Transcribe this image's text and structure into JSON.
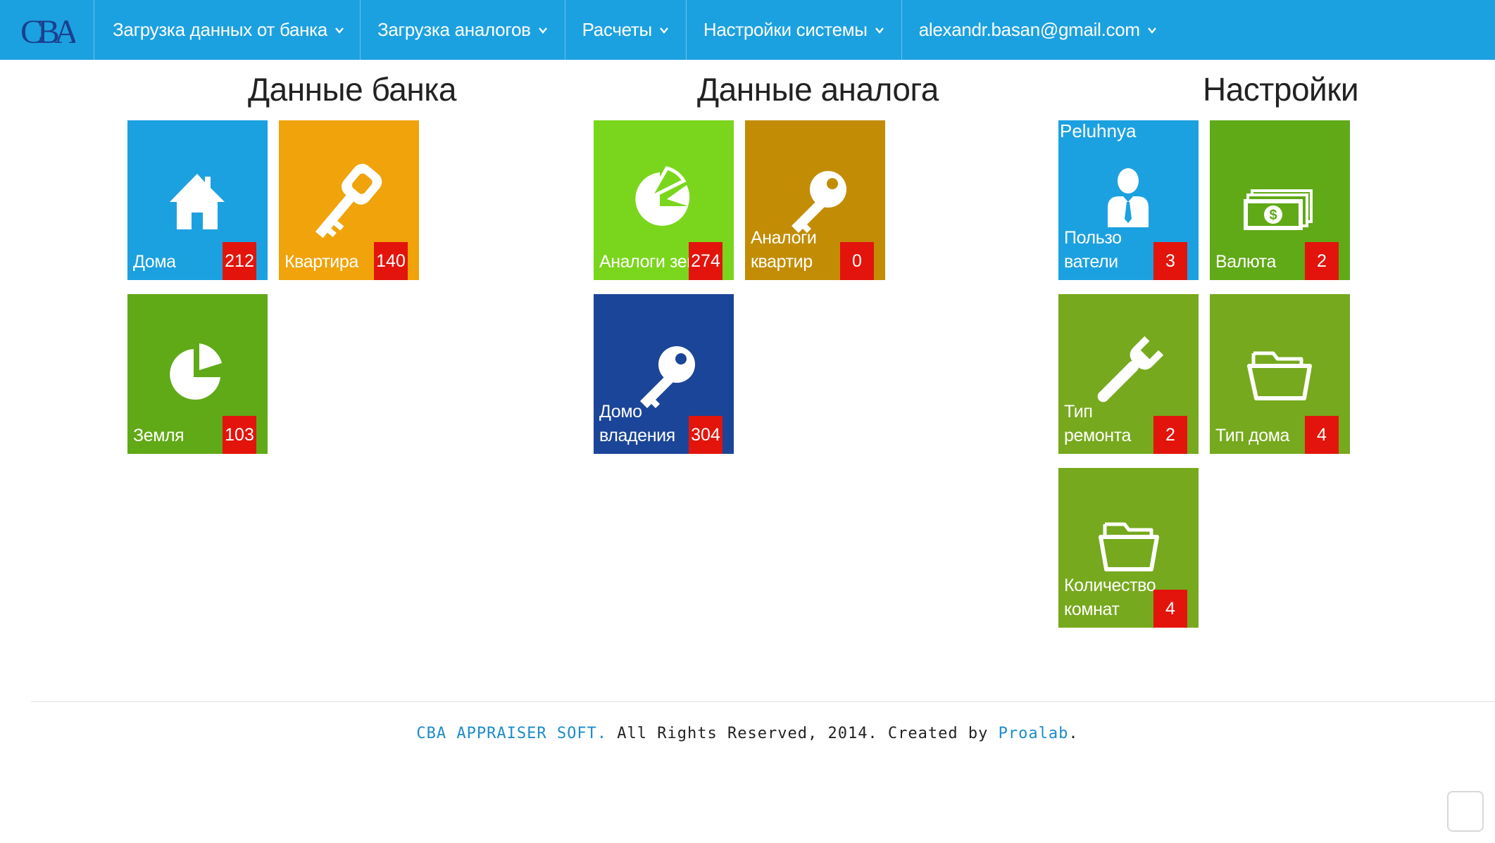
{
  "nav": {
    "brand": "CBA",
    "items": [
      {
        "label": "Загрузка данных от банка"
      },
      {
        "label": "Загрузка аналогов"
      },
      {
        "label": "Расчеты"
      },
      {
        "label": "Настройки системы"
      },
      {
        "label": "alexandr.basan@gmail.com"
      }
    ]
  },
  "sections": {
    "bank": {
      "title": "Данные банка"
    },
    "analog": {
      "title": "Данные аналога"
    },
    "settings": {
      "title": "Настройки"
    }
  },
  "tiles": {
    "houses": {
      "label": "Дома",
      "count": "212",
      "color": "#1ca1e0",
      "icon": "house-icon"
    },
    "apartment": {
      "label": "Квартира",
      "count": "140",
      "color": "#f0a30a",
      "icon": "key-icon"
    },
    "land": {
      "label": "Земля",
      "count": "103",
      "color": "#60a917",
      "icon": "pie-chart-icon"
    },
    "analog_land": {
      "label": "Аналоги земли",
      "count": "274",
      "color": "#7ad61d",
      "icon": "pie-chart-icon"
    },
    "analog_apartments": {
      "label": "Аналоги\nквартир",
      "count": "0",
      "color": "#c28d05",
      "icon": "key-icon"
    },
    "households": {
      "label": "Домо\nвладения",
      "count": "304",
      "color": "#1b4598",
      "icon": "key-icon"
    },
    "users": {
      "top": "Peluhnya",
      "label": "Пользо\nватели",
      "count": "3",
      "color": "#1ca1e0",
      "icon": "user-icon"
    },
    "currency": {
      "label": "Валюта",
      "count": "2",
      "color": "#60a917",
      "icon": "money-icon"
    },
    "repair_type": {
      "label": "Тип\nремонта",
      "count": "2",
      "color": "#76a91d",
      "icon": "wrench-icon"
    },
    "house_type": {
      "label": "Тип дома",
      "count": "4",
      "color": "#76a91d",
      "icon": "folder-icon"
    },
    "rooms": {
      "label": "Количество\nкомнат",
      "count": "4",
      "color": "#76a91d",
      "icon": "folder-icon"
    }
  },
  "footer": {
    "brand": "CBA APPRAISER SOFT.",
    "text": " All Rights Reserved, 2014. Created by ",
    "creator": "Proalab",
    "end": "."
  }
}
